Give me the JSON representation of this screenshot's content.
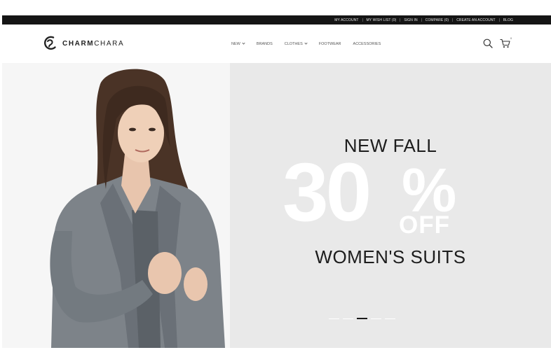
{
  "topbar": {
    "links": [
      "MY ACCOUNT",
      "MY WISH LIST (0)",
      "SIGN IN",
      "COMPARE (0)",
      "CREATE AN ACCOUNT",
      "BLOG"
    ]
  },
  "header": {
    "logo_bold": "CHARM",
    "logo_light": "CHARA",
    "nav": [
      {
        "label": "NEW",
        "dropdown": true
      },
      {
        "label": "BRANDS",
        "dropdown": false
      },
      {
        "label": "CLOTHES",
        "dropdown": true
      },
      {
        "label": "FOOTWEAR",
        "dropdown": false
      },
      {
        "label": "ACCESSORIES",
        "dropdown": false
      }
    ],
    "cart_count": "0"
  },
  "hero": {
    "line1": "NEW FALL",
    "big_number": "30",
    "percent": "%",
    "off": "OFF",
    "line2": "WOMEN'S SUITS",
    "slides_total": 5,
    "active_slide": 3
  },
  "colors": {
    "topbar_bg": "#151515",
    "hero_bg": "#e9e9e9",
    "text_dark": "#1d1d1d"
  }
}
